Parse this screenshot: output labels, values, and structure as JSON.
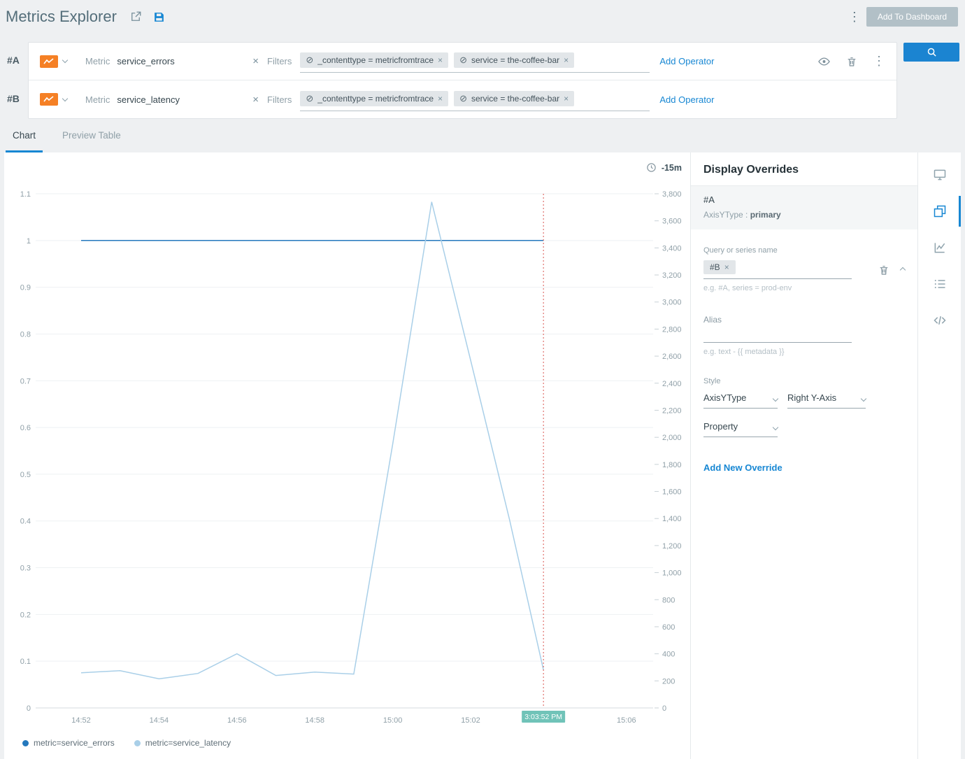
{
  "header": {
    "title": "Metrics Explorer",
    "add_to_dashboard_label": "Add To Dashboard"
  },
  "icons": {
    "exclude_glyph": "⊘",
    "remove_glyph": "×",
    "kebab_glyph": "⋮"
  },
  "queries": [
    {
      "row_id": "#A",
      "metric_label": "Metric",
      "metric_value": "service_errors",
      "filters_label": "Filters",
      "filters": [
        "_contenttype = metricfromtrace",
        "service = the-coffee-bar"
      ],
      "add_operator_label": "Add Operator"
    },
    {
      "row_id": "#B",
      "metric_label": "Metric",
      "metric_value": "service_latency",
      "filters_label": "Filters",
      "filters": [
        "_contenttype = metricfromtrace",
        "service = the-coffee-bar"
      ],
      "add_operator_label": "Add Operator"
    }
  ],
  "tabs": {
    "chart_label": "Chart",
    "preview_table_label": "Preview Table"
  },
  "chart": {
    "time_range_label": "-15m",
    "cursor_time_label": "3:03:52 PM"
  },
  "chart_data": {
    "type": "line",
    "x_tick_labels": [
      "14:52",
      "14:54",
      "14:56",
      "14:58",
      "15:00",
      "15:02",
      "15:06"
    ],
    "x_tick_minutes": [
      0,
      2,
      4,
      6,
      8,
      10,
      14
    ],
    "left_axis": {
      "min": 0,
      "max": 1.1,
      "ticks": [
        "0",
        "0.1",
        "0.2",
        "0.3",
        "0.4",
        "0.5",
        "0.6",
        "0.7",
        "0.8",
        "0.9",
        "1",
        "1.1"
      ]
    },
    "right_axis": {
      "min": 0,
      "max": 3800,
      "ticks": [
        "0",
        "200",
        "400",
        "600",
        "800",
        "1,000",
        "1,200",
        "1,400",
        "1,600",
        "1,800",
        "2,000",
        "2,200",
        "2,400",
        "2,600",
        "2,800",
        "3,000",
        "3,200",
        "3,400",
        "3,600",
        "3,800"
      ]
    },
    "cursor_minute": 11.87,
    "series": [
      {
        "name": "metric=service_errors",
        "axis": "left",
        "color": "#2478bd",
        "points": [
          [
            0,
            1
          ],
          [
            11.87,
            1
          ]
        ]
      },
      {
        "name": "metric=service_latency",
        "axis": "right",
        "color": "#a9cfe8",
        "points": [
          [
            0,
            260
          ],
          [
            1,
            275
          ],
          [
            2,
            215
          ],
          [
            3,
            255
          ],
          [
            4,
            400
          ],
          [
            5,
            240
          ],
          [
            6,
            265
          ],
          [
            7,
            250
          ],
          [
            8,
            1950
          ],
          [
            9,
            3740
          ],
          [
            10,
            2570
          ],
          [
            11,
            1390
          ],
          [
            11.87,
            280
          ]
        ]
      }
    ],
    "legend_position": "bottom",
    "grid": true
  },
  "legend": [
    {
      "label": "metric=service_errors",
      "color": "#2478bd"
    },
    {
      "label": "metric=service_latency",
      "color": "#a9cfe8"
    }
  ],
  "overrides_panel": {
    "title": "Display Overrides",
    "summary": {
      "id": "#A",
      "prop_label": "AxisYType :",
      "prop_value": "primary"
    },
    "query_series_label": "Query or series name",
    "query_chip_label": "#B",
    "query_hint": "e.g. #A, series = prod-env",
    "alias_label": "Alias",
    "alias_hint": "e.g. text - {{ metadata }}",
    "style_label": "Style",
    "style_property_select_value": "AxisYType",
    "style_axis_select_value": "Right Y-Axis",
    "property_select_value": "Property",
    "add_new_override_label": "Add New Override"
  }
}
